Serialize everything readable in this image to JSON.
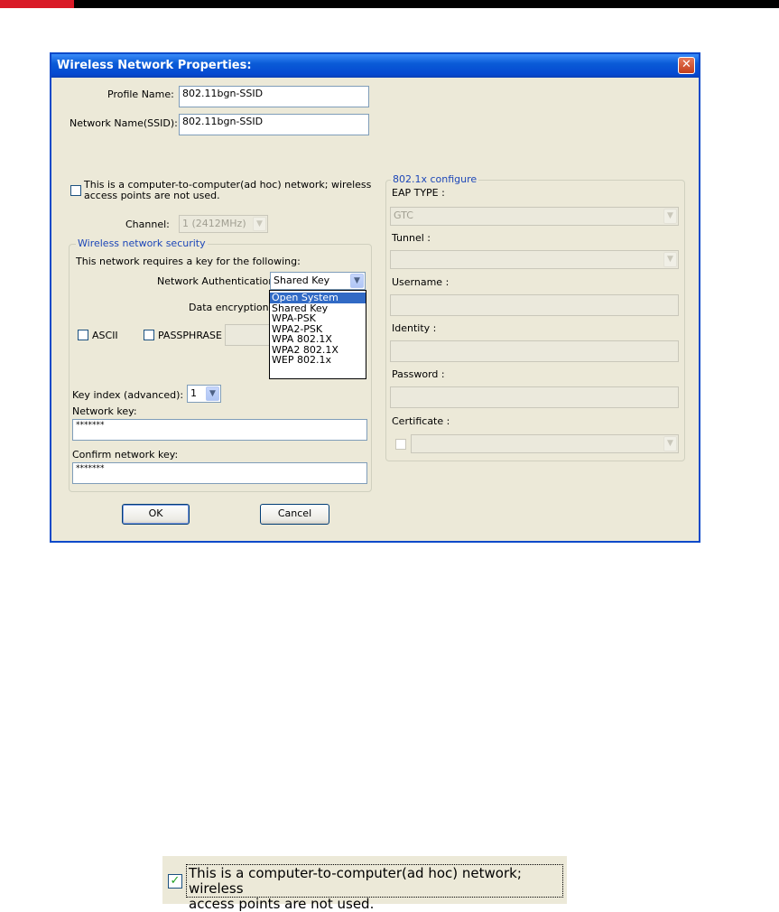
{
  "dialog": {
    "title": "Wireless Network Properties:",
    "close_glyph": "✕",
    "profile_name_label": "Profile Name:",
    "profile_name_value": "802.11bgn-SSID",
    "ssid_label": "Network Name(SSID):",
    "ssid_value": "802.11bgn-SSID",
    "adhoc_label_line1": "This is a computer-to-computer(ad hoc) network; wireless",
    "adhoc_label_line2": "access points are not used.",
    "channel_label": "Channel:",
    "channel_value": "1  (2412MHz)",
    "security": {
      "group_label": "Wireless network security",
      "requires_key_text": "This network requires a key for the following:",
      "auth_label": "Network Authentication:",
      "auth_value": "Shared Key",
      "auth_options": [
        "Open System",
        "Shared Key",
        "WPA-PSK",
        "WPA2-PSK",
        "WPA 802.1X",
        "WPA2 802.1X",
        "WEP 802.1x"
      ],
      "auth_highlighted": "Open System",
      "encryption_label": "Data encryption:",
      "ascii_label": "ASCII",
      "passphrase_label": "PASSPHRASE",
      "key_index_label": "Key index (advanced):",
      "key_index_value": "1",
      "network_key_label": "Network key:",
      "network_key_value": "*******",
      "confirm_key_label": "Confirm network key:",
      "confirm_key_value": "*******"
    },
    "dot1x": {
      "group_label": "802.1x configure",
      "eap_type_label": "EAP TYPE :",
      "eap_type_value": "GTC",
      "tunnel_label": "Tunnel :",
      "username_label": "Username :",
      "identity_label": "Identity :",
      "password_label": "Password :",
      "certificate_label": "Certificate :"
    },
    "ok_label": "OK",
    "cancel_label": "Cancel"
  },
  "zoom": {
    "line1": "This is a computer-to-computer(ad hoc) network; wireless",
    "line2": "access points are not used.",
    "check_glyph": "✓"
  },
  "colors": {
    "title_bar": "#0a5bd7",
    "dialog_bg": "#ece9d8",
    "group_label": "#1d47b8",
    "selection": "#316ac5",
    "brand_red": "#d91a27"
  }
}
